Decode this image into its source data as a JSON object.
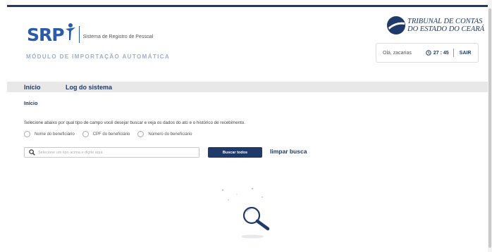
{
  "header": {
    "logo_text": "SRP",
    "system_name": "Sistema de Registro de Pessoal",
    "module_title": "MÓDULO DE IMPORTAÇÃO AUTOMÁTICA",
    "org_name_line1": "TRIBUNAL DE CONTAS",
    "org_name_line2": "DO ESTADO DO CEARÁ"
  },
  "user_box": {
    "greeting": "Olá, zacarias",
    "session_time": "27 : 45",
    "logout_label": "SAIR"
  },
  "nav": {
    "items": [
      {
        "label": "Início"
      },
      {
        "label": "Log do sistema"
      }
    ]
  },
  "breadcrumb": "Início",
  "search": {
    "instructions": "Selecione abaixo por qual tipo de campo você desejar buscar e veja os dados do ato e o histórico de recebimento.",
    "options": [
      {
        "label": "Nome do beneficiário"
      },
      {
        "label": "CPF do beneficiário"
      },
      {
        "label": "Número do beneficiário"
      }
    ],
    "placeholder": "Selecione um tipo acima e digite aqui.",
    "search_button_label": "Buscar todos",
    "clear_label": "limpar busca"
  },
  "colors": {
    "primary": "#1f3a68",
    "logo_blue": "#2b5aa8",
    "module_title": "#9ab0cc",
    "nav_bg": "#e8e8e8"
  },
  "icons": {
    "clock": "clock-icon",
    "search": "search-icon",
    "empty_state": "magnifier-illustration"
  }
}
